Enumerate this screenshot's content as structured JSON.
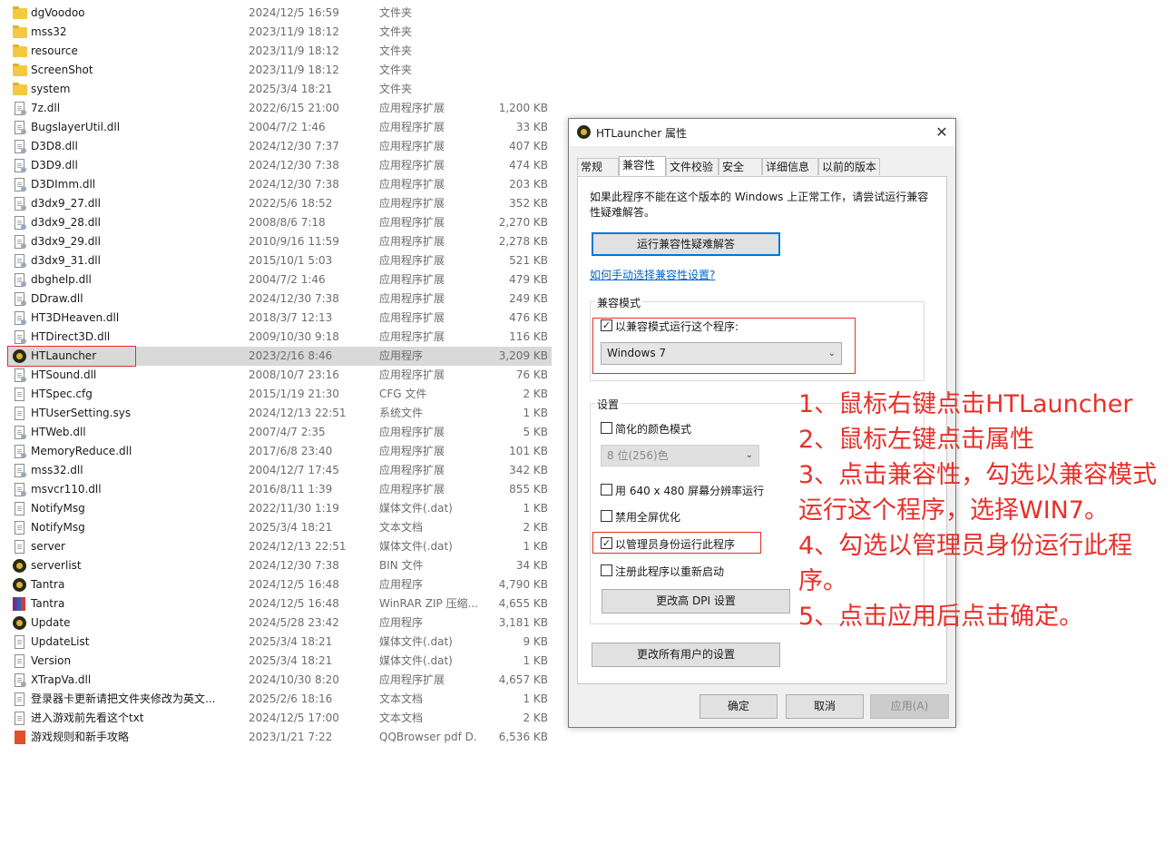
{
  "files": [
    {
      "name": "dgVoodoo",
      "date": "2024/12/5 16:59",
      "type": "文件夹",
      "size": "",
      "icon": "folder-icon"
    },
    {
      "name": "mss32",
      "date": "2023/11/9 18:12",
      "type": "文件夹",
      "size": "",
      "icon": "folder-icon"
    },
    {
      "name": "resource",
      "date": "2023/11/9 18:12",
      "type": "文件夹",
      "size": "",
      "icon": "folder-icon"
    },
    {
      "name": "ScreenShot",
      "date": "2023/11/9 18:12",
      "type": "文件夹",
      "size": "",
      "icon": "folder-icon"
    },
    {
      "name": "system",
      "date": "2025/3/4 18:21",
      "type": "文件夹",
      "size": "",
      "icon": "folder-icon"
    },
    {
      "name": "7z.dll",
      "date": "2022/6/15 21:00",
      "type": "应用程序扩展",
      "size": "1,200 KB",
      "icon": "dll-icon"
    },
    {
      "name": "BugslayerUtil.dll",
      "date": "2004/7/2 1:46",
      "type": "应用程序扩展",
      "size": "33 KB",
      "icon": "dll-icon"
    },
    {
      "name": "D3D8.dll",
      "date": "2024/12/30 7:37",
      "type": "应用程序扩展",
      "size": "407 KB",
      "icon": "dll-icon"
    },
    {
      "name": "D3D9.dll",
      "date": "2024/12/30 7:38",
      "type": "应用程序扩展",
      "size": "474 KB",
      "icon": "dll-icon"
    },
    {
      "name": "D3DImm.dll",
      "date": "2024/12/30 7:38",
      "type": "应用程序扩展",
      "size": "203 KB",
      "icon": "dll-icon"
    },
    {
      "name": "d3dx9_27.dll",
      "date": "2022/5/6 18:52",
      "type": "应用程序扩展",
      "size": "352 KB",
      "icon": "dll-icon"
    },
    {
      "name": "d3dx9_28.dll",
      "date": "2008/8/6 7:18",
      "type": "应用程序扩展",
      "size": "2,270 KB",
      "icon": "dll-icon"
    },
    {
      "name": "d3dx9_29.dll",
      "date": "2010/9/16 11:59",
      "type": "应用程序扩展",
      "size": "2,278 KB",
      "icon": "dll-icon"
    },
    {
      "name": "d3dx9_31.dll",
      "date": "2015/10/1 5:03",
      "type": "应用程序扩展",
      "size": "521 KB",
      "icon": "dll-icon"
    },
    {
      "name": "dbghelp.dll",
      "date": "2004/7/2 1:46",
      "type": "应用程序扩展",
      "size": "479 KB",
      "icon": "dll-icon"
    },
    {
      "name": "DDraw.dll",
      "date": "2024/12/30 7:38",
      "type": "应用程序扩展",
      "size": "249 KB",
      "icon": "dll-icon"
    },
    {
      "name": "HT3DHeaven.dll",
      "date": "2018/3/7 12:13",
      "type": "应用程序扩展",
      "size": "476 KB",
      "icon": "dll-icon"
    },
    {
      "name": "HTDirect3D.dll",
      "date": "2009/10/30 9:18",
      "type": "应用程序扩展",
      "size": "116 KB",
      "icon": "dll-icon"
    },
    {
      "name": "HTLauncher",
      "date": "2023/2/16 8:46",
      "type": "应用程序",
      "size": "3,209 KB",
      "icon": "app-icon",
      "selected": true
    },
    {
      "name": "HTSound.dll",
      "date": "2008/10/7 23:16",
      "type": "应用程序扩展",
      "size": "76 KB",
      "icon": "dll-icon"
    },
    {
      "name": "HTSpec.cfg",
      "date": "2015/1/19 21:30",
      "type": "CFG 文件",
      "size": "2 KB",
      "icon": "file-icon"
    },
    {
      "name": "HTUserSetting.sys",
      "date": "2024/12/13 22:51",
      "type": "系统文件",
      "size": "1 KB",
      "icon": "file-icon"
    },
    {
      "name": "HTWeb.dll",
      "date": "2007/4/7 2:35",
      "type": "应用程序扩展",
      "size": "5 KB",
      "icon": "dll-icon"
    },
    {
      "name": "MemoryReduce.dll",
      "date": "2017/6/8 23:40",
      "type": "应用程序扩展",
      "size": "101 KB",
      "icon": "dll-icon"
    },
    {
      "name": "mss32.dll",
      "date": "2004/12/7 17:45",
      "type": "应用程序扩展",
      "size": "342 KB",
      "icon": "dll-icon"
    },
    {
      "name": "msvcr110.dll",
      "date": "2016/8/11 1:39",
      "type": "应用程序扩展",
      "size": "855 KB",
      "icon": "dll-icon"
    },
    {
      "name": "NotifyMsg",
      "date": "2022/11/30 1:19",
      "type": "媒体文件(.dat)",
      "size": "1 KB",
      "icon": "file-icon"
    },
    {
      "name": "NotifyMsg",
      "date": "2025/3/4 18:21",
      "type": "文本文档",
      "size": "2 KB",
      "icon": "file-icon"
    },
    {
      "name": "server",
      "date": "2024/12/13 22:51",
      "type": "媒体文件(.dat)",
      "size": "1 KB",
      "icon": "file-icon"
    },
    {
      "name": "serverlist",
      "date": "2024/12/30 7:38",
      "type": "BIN 文件",
      "size": "34 KB",
      "icon": "app-icon"
    },
    {
      "name": "Tantra",
      "date": "2024/12/5 16:48",
      "type": "应用程序",
      "size": "4,790 KB",
      "icon": "app-icon"
    },
    {
      "name": "Tantra",
      "date": "2024/12/5 16:48",
      "type": "WinRAR ZIP 压缩...",
      "size": "4,655 KB",
      "icon": "winrar-icon"
    },
    {
      "name": "Update",
      "date": "2024/5/28 23:42",
      "type": "应用程序",
      "size": "3,181 KB",
      "icon": "app-icon"
    },
    {
      "name": "UpdateList",
      "date": "2025/3/4 18:21",
      "type": "媒体文件(.dat)",
      "size": "9 KB",
      "icon": "file-icon"
    },
    {
      "name": "Version",
      "date": "2025/3/4 18:21",
      "type": "媒体文件(.dat)",
      "size": "1 KB",
      "icon": "file-icon"
    },
    {
      "name": "XTrapVa.dll",
      "date": "2024/10/30 8:20",
      "type": "应用程序扩展",
      "size": "4,657 KB",
      "icon": "dll-icon"
    },
    {
      "name": "登录器卡更新请把文件夹修改为英文...",
      "date": "2025/2/6 18:16",
      "type": "文本文档",
      "size": "1 KB",
      "icon": "file-icon"
    },
    {
      "name": "进入游戏前先看这个txt",
      "date": "2024/12/5 17:00",
      "type": "文本文档",
      "size": "2 KB",
      "icon": "file-icon"
    },
    {
      "name": "游戏规则和新手攻略",
      "date": "2023/1/21 7:22",
      "type": "QQBrowser pdf D...",
      "size": "6,536 KB",
      "icon": "pdf-icon"
    }
  ],
  "dialog": {
    "title": "HTLauncher 属性",
    "close": "✕",
    "tabs": [
      "常规",
      "兼容性",
      "文件校验",
      "安全",
      "详细信息",
      "以前的版本"
    ],
    "active_tab": 1,
    "intro": "如果此程序不能在这个版本的 Windows 上正常工作，请尝试运行兼容性疑难解答。",
    "troubleshoot_button": "运行兼容性疑难解答",
    "manual_link": "如何手动选择兼容性设置?",
    "compat_group": "兼容模式",
    "compat_checkbox": "以兼容模式运行这个程序:",
    "compat_checked": true,
    "compat_select": "Windows 7",
    "settings_group": "设置",
    "reduced_color": "简化的颜色模式",
    "color_select": "8 位(256)色",
    "res_640": "用 640 x 480 屏幕分辨率运行",
    "disable_fullscreen": "禁用全屏优化",
    "run_admin": "以管理员身份运行此程序",
    "run_admin_checked": true,
    "register_restart": "注册此程序以重新启动",
    "dpi_button": "更改高 DPI 设置",
    "all_users_button": "更改所有用户的设置",
    "ok": "确定",
    "cancel": "取消",
    "apply": "应用(A)",
    "check_mark": "✓",
    "chevron": "⌄"
  },
  "notes": [
    "1、鼠标右键点击HTLauncher",
    "2、鼠标左键点击属性",
    "3、点击兼容性，勾选以兼容模式运行这个程序，选择WIN7。",
    "4、勾选以管理员身份运行此程序。",
    "5、点击应用后点击确定。"
  ],
  "colors": {
    "annotation": "#e8302a",
    "link": "#0066cc",
    "focus": "#0078d7"
  }
}
